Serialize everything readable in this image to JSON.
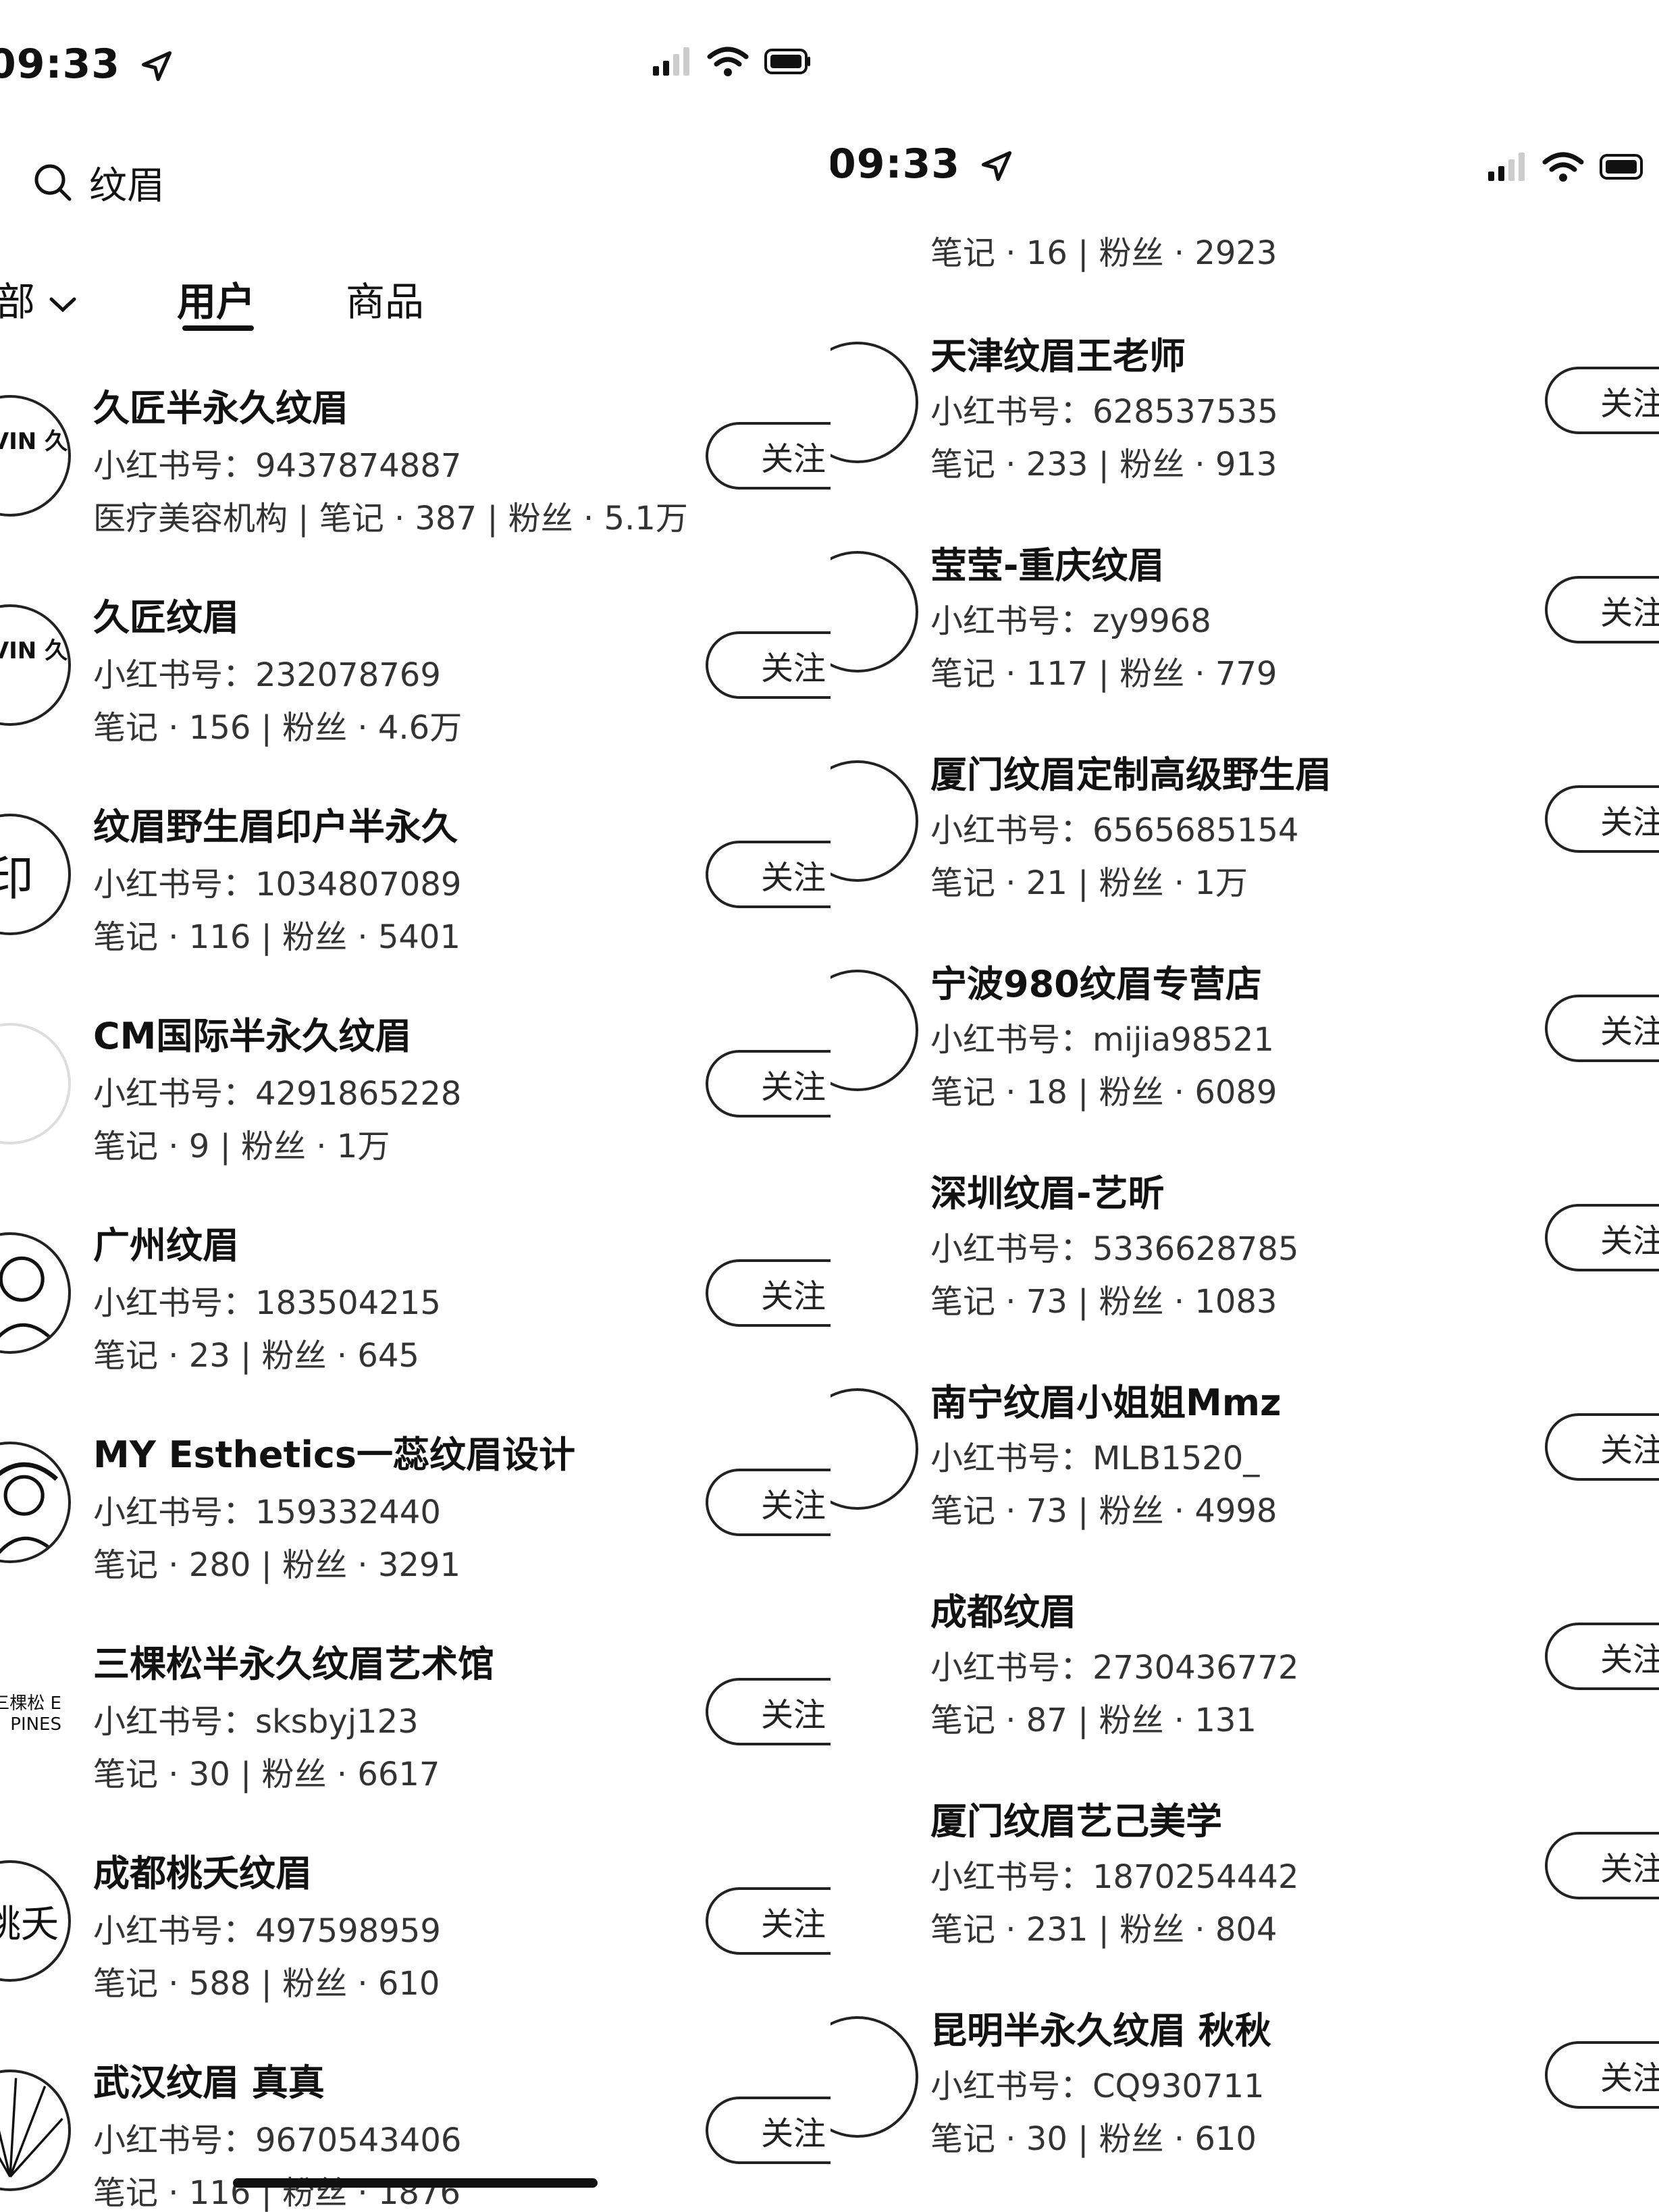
{
  "left": {
    "status": {
      "time": "09:33"
    },
    "search": {
      "query": "纹眉"
    },
    "tabs": [
      {
        "label": "部"
      },
      {
        "label": "用户",
        "active": true
      },
      {
        "label": "商品"
      }
    ],
    "users": [
      {
        "name": "久匠半永久纹眉",
        "id_line": "小红书号：9437874887",
        "stats": "医疗美容机构 | 笔记 · 387 | 粉丝 · 5.1万",
        "avatar_text": "MAVIN 久匠",
        "follow": "关注"
      },
      {
        "name": "久匠纹眉",
        "id_line": "小红书号：232078769",
        "stats": "笔记 · 156 | 粉丝 · 4.6万",
        "avatar_text": "MAVIN 久匠",
        "follow": "关注"
      },
      {
        "name": "纹眉野生眉印户半永久",
        "id_line": "小红书号：1034807089",
        "stats": "笔记 · 116 | 粉丝 · 5401",
        "avatar_text": "印",
        "follow": "关注"
      },
      {
        "name": "CM国际半永久纹眉",
        "id_line": "小红书号：4291865228",
        "stats": "笔记 · 9 | 粉丝 · 1万",
        "avatar_text": "",
        "follow": "关注"
      },
      {
        "name": "广州纹眉",
        "id_line": "小红书号：183504215",
        "stats": "笔记 · 23 | 粉丝 · 645",
        "avatar_text": "",
        "follow": "关注"
      },
      {
        "name": "MY Esthetics一蕊纹眉设计",
        "id_line": "小红书号：159332440",
        "stats": "笔记 · 280 | 粉丝 · 3291",
        "avatar_text": "",
        "follow": "关注"
      },
      {
        "name": "三棵松半永久纹眉艺术馆",
        "id_line": "小红书号：sksbyj123",
        "stats": "笔记 · 30 | 粉丝 · 6617",
        "avatar_text": "三棵松 E PINES",
        "follow": "关注"
      },
      {
        "name": "成都桃夭纹眉",
        "id_line": "小红书号：497598959",
        "stats": "笔记 · 588 | 粉丝 · 610",
        "avatar_text": "桃夭",
        "follow": "关注"
      },
      {
        "name": "武汉纹眉 真真",
        "id_line": "小红书号：9670543406",
        "stats": "笔记 · 116 | 粉丝 · 1876",
        "avatar_text": "",
        "follow": "关注"
      }
    ]
  },
  "right": {
    "status": {
      "time": "09:33"
    },
    "partial_top": {
      "stats": "笔记 · 16 | 粉丝 · 2923"
    },
    "users": [
      {
        "name": "天津纹眉王老师",
        "id_line": "小红书号：628537535",
        "stats": "笔记 · 233 | 粉丝 · 913",
        "follow": "关注"
      },
      {
        "name": "莹莹-重庆纹眉",
        "id_line": "小红书号：zy9968",
        "stats": "笔记 · 117 | 粉丝 · 779",
        "follow": "关注"
      },
      {
        "name": "厦门纹眉定制高级野生眉",
        "id_line": "小红书号：6565685154",
        "stats": "笔记 · 21 | 粉丝 · 1万",
        "follow": "关注"
      },
      {
        "name": "宁波980纹眉专营店",
        "id_line": "小红书号：mijia98521",
        "stats": "笔记 · 18 | 粉丝 · 6089",
        "follow": "关注"
      },
      {
        "name": "深圳纹眉-艺昕",
        "id_line": "小红书号：5336628785",
        "stats": "笔记 · 73 | 粉丝 · 1083",
        "follow": "关注"
      },
      {
        "name": "南宁纹眉小姐姐Mmz",
        "id_line": "小红书号：MLB1520_",
        "stats": "笔记 · 73 | 粉丝 · 4998",
        "follow": "关注"
      },
      {
        "name": "成都纹眉",
        "id_line": "小红书号：2730436772",
        "stats": "笔记 · 87 | 粉丝 · 131",
        "follow": "关注"
      },
      {
        "name": "厦门纹眉艺己美学",
        "id_line": "小红书号：1870254442",
        "stats": "笔记 · 231 | 粉丝 · 804",
        "follow": "关注"
      },
      {
        "name": "昆明半永久纹眉 秋秋",
        "id_line": "小红书号：CQ930711",
        "stats": "笔记 · 30 | 粉丝 · 610",
        "follow": "关注"
      }
    ]
  }
}
